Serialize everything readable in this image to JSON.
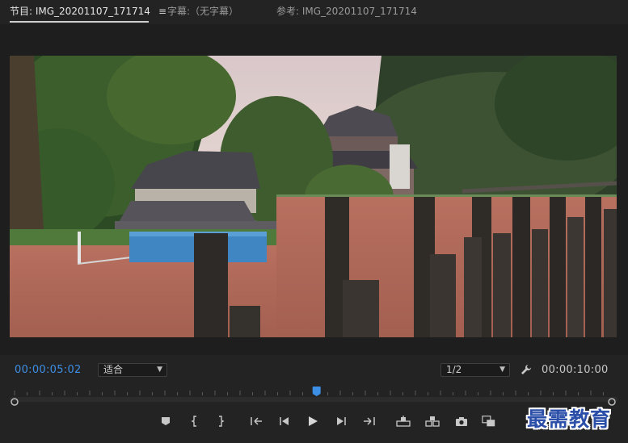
{
  "tabs": [
    {
      "label": "节目: IMG_20201107_171714",
      "active": true,
      "menu_icon": "hamburger-icon"
    },
    {
      "label": "字幕:（无字幕）",
      "active": false
    },
    {
      "label": "参考: IMG_20201107_171714",
      "active": false
    }
  ],
  "playback": {
    "current_timecode": "00:00:05:02",
    "duration_timecode": "00:00:10:00",
    "zoom_select": "适合",
    "resolution_select": "1/2",
    "playhead_fraction": 0.505
  },
  "transport_buttons": [
    {
      "name": "add-marker-icon"
    },
    {
      "name": "mark-in-icon"
    },
    {
      "name": "mark-out-icon"
    },
    {
      "name": "go-to-in-icon"
    },
    {
      "name": "step-back-icon"
    },
    {
      "name": "play-icon"
    },
    {
      "name": "step-forward-icon"
    },
    {
      "name": "go-to-out-icon"
    },
    {
      "name": "lift-icon"
    },
    {
      "name": "extract-icon"
    },
    {
      "name": "export-frame-icon"
    },
    {
      "name": "comparison-view-icon"
    }
  ],
  "watermark": "最需教育",
  "colors": {
    "accent_blue": "#3d8fe6",
    "panel_bg": "#232323",
    "viewer_bg": "#1e1e1e"
  }
}
